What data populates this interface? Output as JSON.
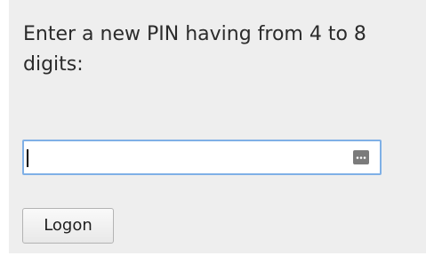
{
  "prompt": {
    "text": "Enter a new PIN having from 4 to 8 digits:"
  },
  "pin_field": {
    "value": "",
    "placeholder": "",
    "reveal_icon": "password-reveal-icon"
  },
  "logon_button": {
    "label": "Logon"
  },
  "colors": {
    "panel_background": "#eeeeee",
    "field_focus_border": "#7fb0e6"
  }
}
